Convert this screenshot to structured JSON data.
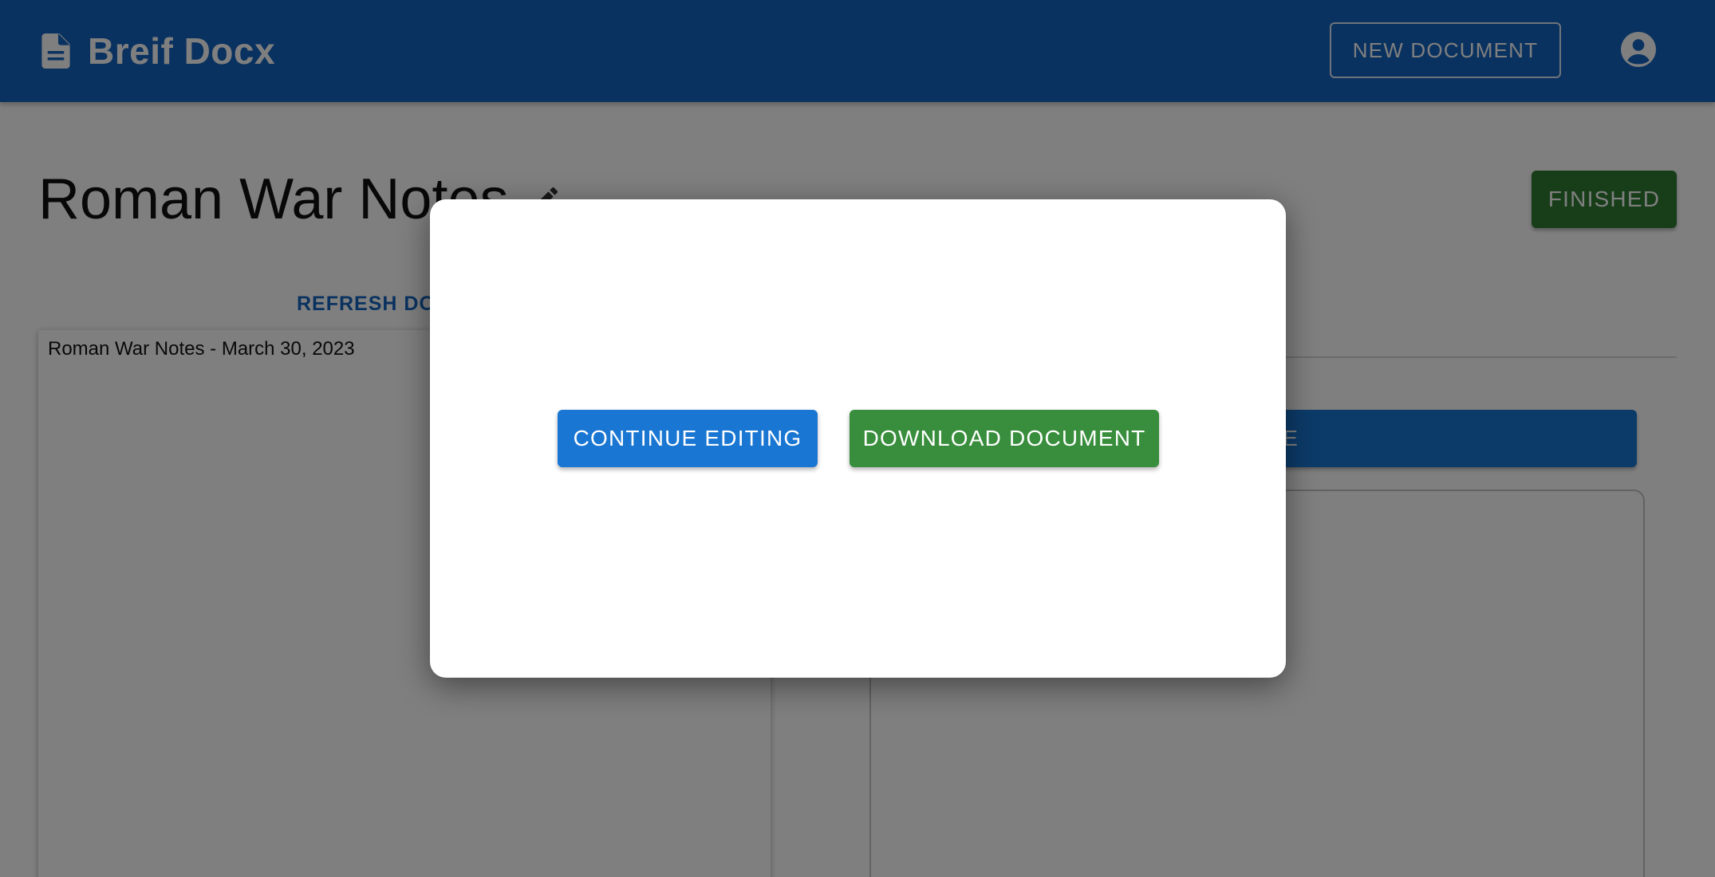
{
  "app": {
    "title": "Breif Docx",
    "icon": "document-icon"
  },
  "header": {
    "new_document_label": "NEW DOCUMENT",
    "account_icon": "account-circle-icon"
  },
  "document": {
    "title": "Roman War Notes",
    "edit_icon": "pencil-icon",
    "finished_label": "FINISHED",
    "refresh_label": "REFRESH DOC",
    "content_first_line": "Roman War Notes - March 30, 2023"
  },
  "right_panel": {
    "action_label_visible": "TE"
  },
  "modal": {
    "continue_label": "CONTINUE EDITING",
    "download_label": "DOWNLOAD DOCUMENT"
  },
  "colors": {
    "primary": "#1565c0",
    "primary_button": "#1976d2",
    "success": "#2e7d32",
    "success_button": "#388e3c",
    "backdrop": "rgba(0,0,0,0.5)"
  }
}
